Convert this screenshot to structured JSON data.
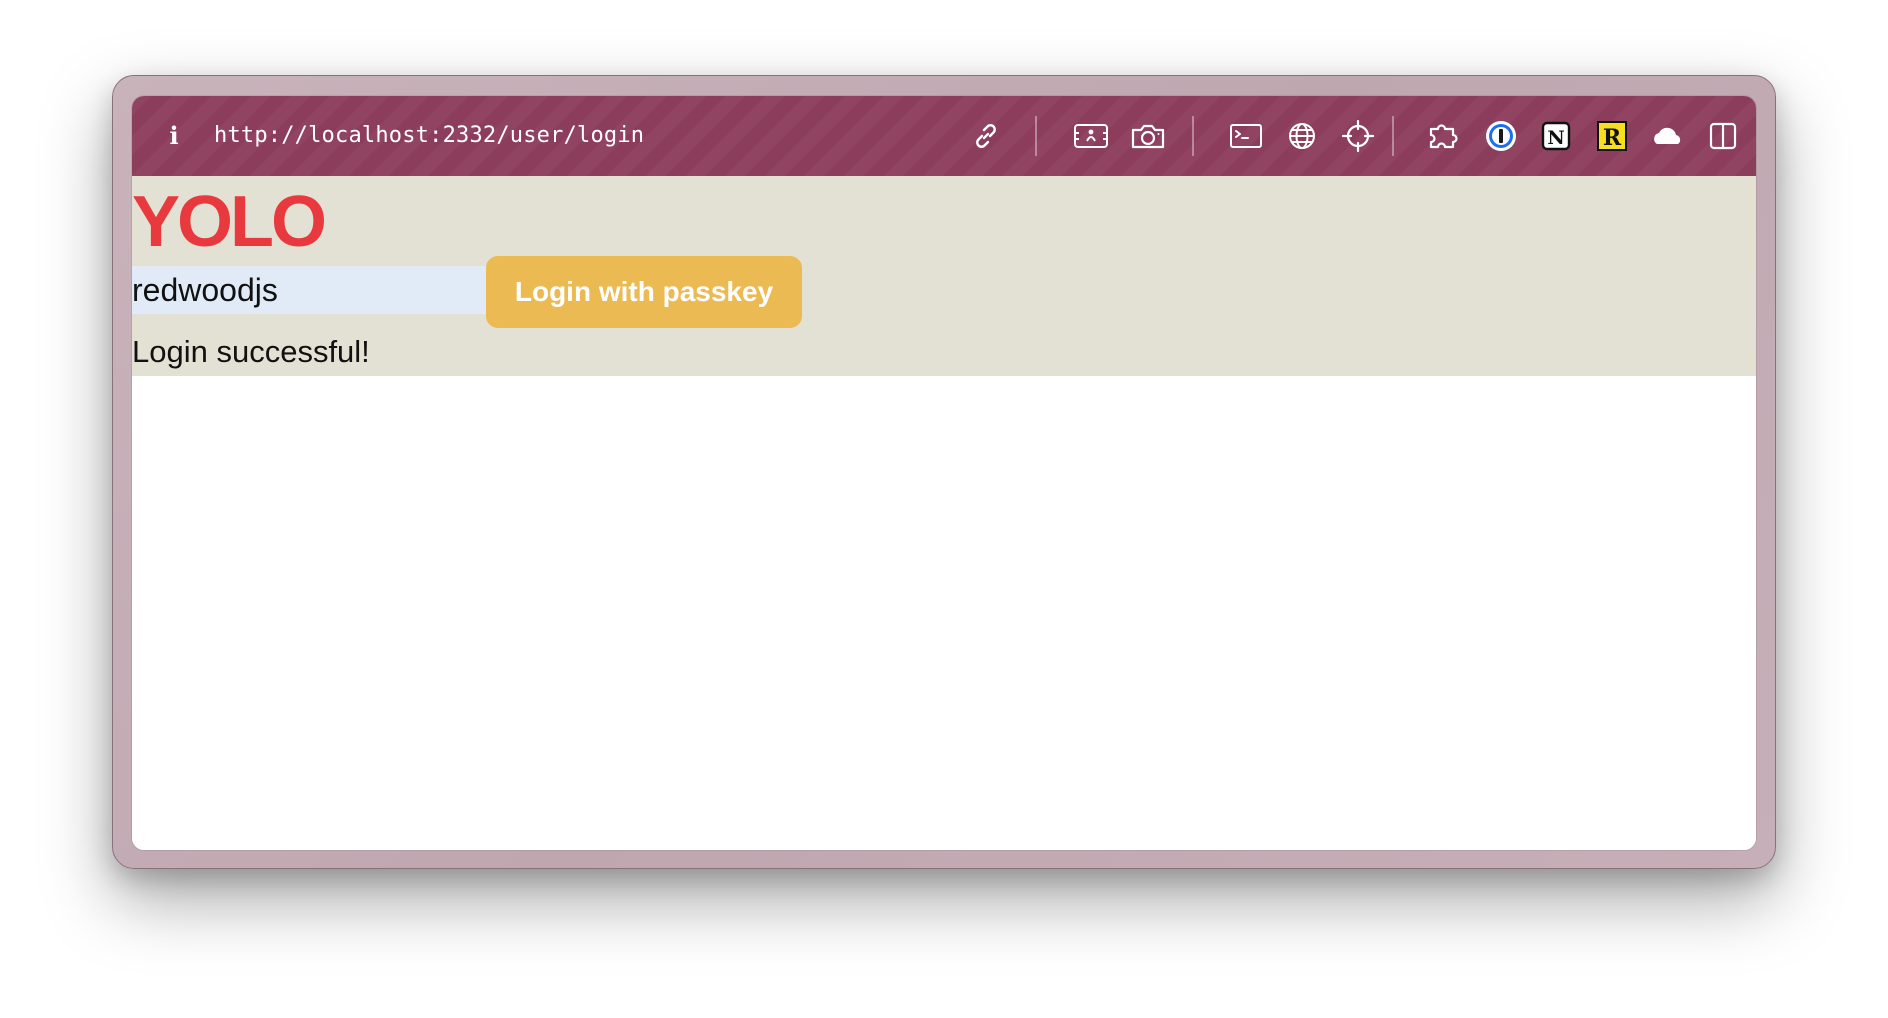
{
  "browser": {
    "url": "http://localhost:2332/user/login",
    "info_glyph": "i",
    "toolbar_icons": [
      "link-icon",
      "image-capture-icon",
      "camera-icon",
      "terminal-icon",
      "globe-icon",
      "crosshair-icon",
      "extensions-puzzle-icon",
      "onepassword-icon",
      "notion-icon",
      "r-extension-icon",
      "cloud-icon",
      "sidebar-toggle-icon"
    ],
    "toolbar_color": "#8c3d5b"
  },
  "page": {
    "title": "YOLO",
    "username_value": "redwoodjs",
    "login_button_label": "Login with passkey",
    "status_message": "Login successful!",
    "colors": {
      "title": "#e8393f",
      "button": "#ecba53",
      "header_background": "#e3e1d4",
      "input_background": "#e1ebf8"
    }
  },
  "icons": {
    "notion_letter": "N",
    "r_letter": "R",
    "onepassword_letter": "I"
  }
}
